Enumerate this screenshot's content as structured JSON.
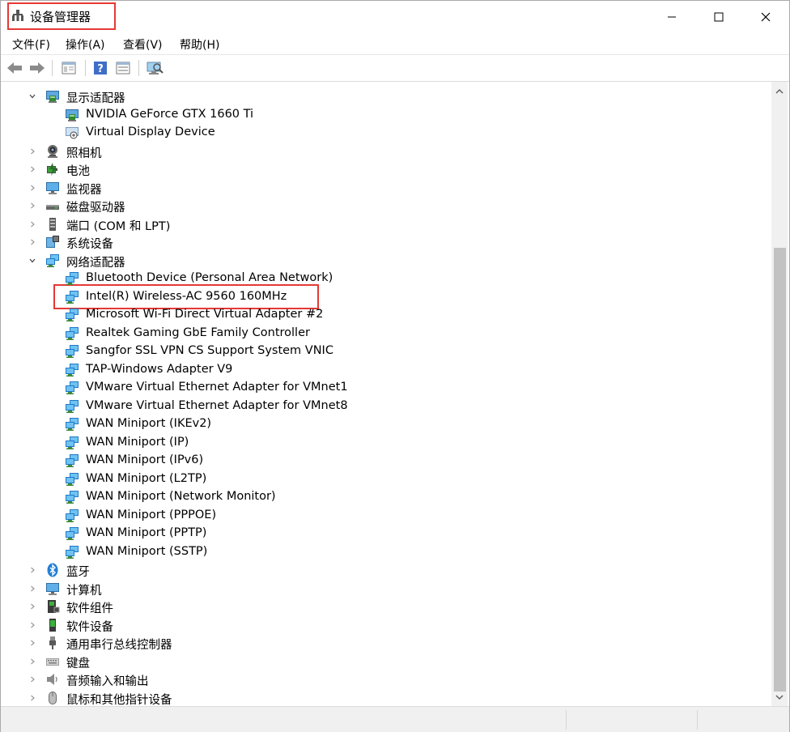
{
  "window": {
    "title": "设备管理器",
    "minimize_glyph": "—",
    "maximize_glyph": "☐",
    "close_glyph": "✕"
  },
  "menu": {
    "items": [
      "文件(F)",
      "操作(A)",
      "查看(V)",
      "帮助(H)"
    ]
  },
  "toolbar": {
    "buttons": [
      "back-icon",
      "forward-icon",
      "properties-icon",
      "help-icon",
      "view-icon",
      "scan-hardware-icon"
    ]
  },
  "tree": {
    "rows": [
      {
        "label": "显示适配器",
        "expanded": true,
        "level": 0,
        "icon": "display-adapter-icon"
      },
      {
        "label": "NVIDIA GeForce GTX 1660 Ti",
        "level": 1,
        "icon": "display-adapter-icon"
      },
      {
        "label": "Virtual Display Device",
        "level": 1,
        "icon": "virtual-display-icon"
      },
      {
        "label": "照相机",
        "expanded": false,
        "level": 0,
        "icon": "camera-icon"
      },
      {
        "label": "电池",
        "expanded": false,
        "level": 0,
        "icon": "battery-icon"
      },
      {
        "label": "监视器",
        "expanded": false,
        "level": 0,
        "icon": "monitor-icon"
      },
      {
        "label": "磁盘驱动器",
        "expanded": false,
        "level": 0,
        "icon": "disk-drive-icon"
      },
      {
        "label": "端口 (COM 和 LPT)",
        "expanded": false,
        "level": 0,
        "icon": "port-icon"
      },
      {
        "label": "系统设备",
        "expanded": false,
        "level": 0,
        "icon": "system-device-icon"
      },
      {
        "label": "网络适配器",
        "expanded": true,
        "level": 0,
        "icon": "network-adapter-icon"
      },
      {
        "label": "Bluetooth Device (Personal Area Network)",
        "level": 1,
        "icon": "network-adapter-icon"
      },
      {
        "label": "Intel(R) Wireless-AC 9560 160MHz",
        "level": 1,
        "icon": "network-adapter-icon",
        "highlighted": true
      },
      {
        "label": "Microsoft Wi-Fi Direct Virtual Adapter #2",
        "level": 1,
        "icon": "network-adapter-icon"
      },
      {
        "label": "Realtek Gaming GbE Family Controller",
        "level": 1,
        "icon": "network-adapter-icon"
      },
      {
        "label": "Sangfor SSL VPN CS Support System VNIC",
        "level": 1,
        "icon": "network-adapter-icon"
      },
      {
        "label": "TAP-Windows Adapter V9",
        "level": 1,
        "icon": "network-adapter-icon"
      },
      {
        "label": "VMware Virtual Ethernet Adapter for VMnet1",
        "level": 1,
        "icon": "network-adapter-icon"
      },
      {
        "label": "VMware Virtual Ethernet Adapter for VMnet8",
        "level": 1,
        "icon": "network-adapter-icon"
      },
      {
        "label": "WAN Miniport (IKEv2)",
        "level": 1,
        "icon": "network-adapter-icon"
      },
      {
        "label": "WAN Miniport (IP)",
        "level": 1,
        "icon": "network-adapter-icon"
      },
      {
        "label": "WAN Miniport (IPv6)",
        "level": 1,
        "icon": "network-adapter-icon"
      },
      {
        "label": "WAN Miniport (L2TP)",
        "level": 1,
        "icon": "network-adapter-icon"
      },
      {
        "label": "WAN Miniport (Network Monitor)",
        "level": 1,
        "icon": "network-adapter-icon"
      },
      {
        "label": "WAN Miniport (PPPOE)",
        "level": 1,
        "icon": "network-adapter-icon"
      },
      {
        "label": "WAN Miniport (PPTP)",
        "level": 1,
        "icon": "network-adapter-icon"
      },
      {
        "label": "WAN Miniport (SSTP)",
        "level": 1,
        "icon": "network-adapter-icon"
      },
      {
        "label": "蓝牙",
        "expanded": false,
        "level": 0,
        "icon": "bluetooth-icon"
      },
      {
        "label": "计算机",
        "expanded": false,
        "level": 0,
        "icon": "computer-icon"
      },
      {
        "label": "软件组件",
        "expanded": false,
        "level": 0,
        "icon": "software-component-icon"
      },
      {
        "label": "软件设备",
        "expanded": false,
        "level": 0,
        "icon": "software-device-icon"
      },
      {
        "label": "通用串行总线控制器",
        "expanded": false,
        "level": 0,
        "icon": "usb-controller-icon"
      },
      {
        "label": "键盘",
        "expanded": false,
        "level": 0,
        "icon": "keyboard-icon"
      },
      {
        "label": "音频输入和输出",
        "expanded": false,
        "level": 0,
        "icon": "audio-icon"
      },
      {
        "label": "鼠标和其他指针设备",
        "expanded": false,
        "level": 0,
        "icon": "mouse-icon"
      }
    ]
  },
  "colors": {
    "highlight_border": "#e53935",
    "network_blue": "#2b8fd6",
    "monitor_green": "#3a9a3a"
  }
}
